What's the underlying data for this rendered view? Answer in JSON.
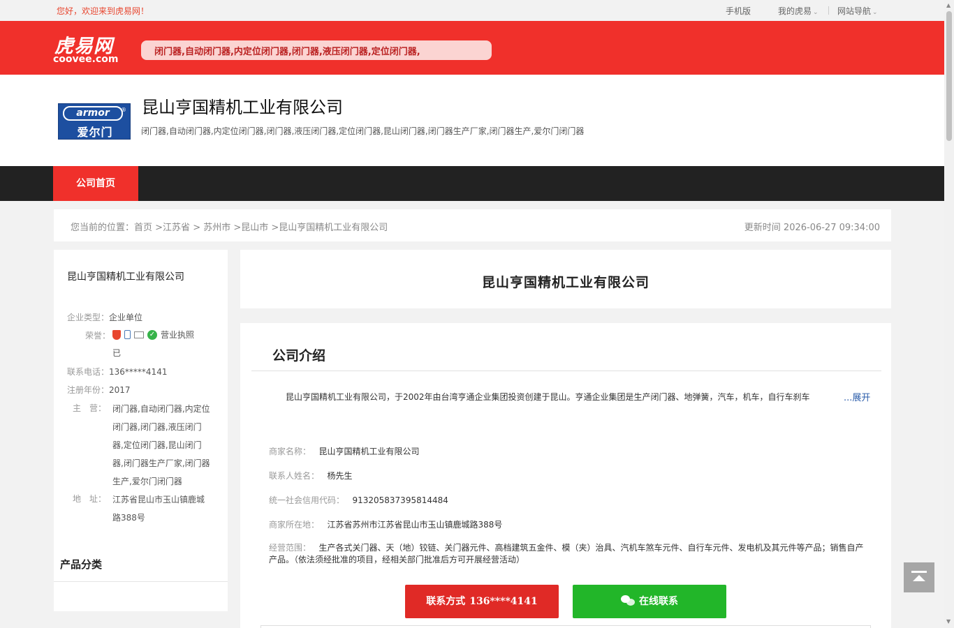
{
  "topbar": {
    "welcome": "您好，欢迎来到虎易网！",
    "mobile": "手机版",
    "mine": "我的虎易",
    "site_nav": "网站导航"
  },
  "header": {
    "logo_text": "虎易网",
    "logo_domain": "coovee.com",
    "keywords": "闭门器,自动闭门器,内定位闭门器,闭门器,液压闭门器,定位闭门器,"
  },
  "company": {
    "logo_brand": "armor",
    "logo_reg": "®",
    "logo_cn": "爱尔门",
    "name": "昆山亨国精机工业有限公司",
    "tags": "闭门器,自动闭门器,内定位闭门器,闭门器,液压闭门器,定位闭门器,昆山闭门器,闭门器生产厂家,闭门器生产,爱尔门闭门器"
  },
  "nav": {
    "home_tab": "公司首页"
  },
  "breadcrumb": {
    "prefix": "您当前的位置：",
    "items": [
      "首页",
      " >江苏省",
      " > 苏州市",
      " >昆山市",
      " >昆山亨国精机工业有限公司"
    ],
    "update_label": "更新时间",
    "update_time": "2026-06-27 09:34:00"
  },
  "sidebar": {
    "title": "昆山亨国精机工业有限公司",
    "type_label": "企业类型：",
    "type_value": "企业单位",
    "honor_label": "荣誉：",
    "honor_license": "营业执照",
    "honor_second": "已",
    "phone_label": "联系电话：",
    "phone_value": "136*****4141",
    "year_label": "注册年份：",
    "year_value": "2017",
    "main_label": "主　营：",
    "main_value": "闭门器,自动闭门器,内定位闭门器,闭门器,液压闭门器,定位闭门器,昆山闭门器,闭门器生产厂家,闭门器生产,爱尔门闭门器",
    "addr_label": "地　址：",
    "addr_value": "江苏省昆山市玉山镇鹿城路388号",
    "category_title": "产品分类"
  },
  "main": {
    "title": "昆山亨国精机工业有限公司",
    "intro_heading": "公司介绍",
    "intro_text": "昆山亨国精机工业有限公司，于2002年由台湾亨通企业集团投资创建于昆山。亨通企业集团是生产闭门器、地弹簧，汽车，机车，自行车刹车",
    "expand": "...展开",
    "info": [
      {
        "label": "商家名称：",
        "value": "昆山亨国精机工业有限公司"
      },
      {
        "label": "联系人姓名：",
        "value": "杨先生"
      },
      {
        "label": "统一社会信用代码：",
        "value": "913205837395814484"
      },
      {
        "label": "商家所在地：",
        "value": "江苏省苏州市江苏省昆山市玉山镇鹿城路388号"
      }
    ],
    "scope_label": "经营范围：",
    "scope_value": "生产各式关门器、天（地）铰链、关门器元件、高档建筑五金件、模（夹）治具、汽机车煞车元件、自行车元件、发电机及其元件等产品；销售自产产品。（依法须经批准的项目，经相关部门批准后方可开展经营活动）",
    "contact_button": "联系方式",
    "contact_number": "136****4141",
    "online_button": "在线联系"
  },
  "colors": {
    "brand_red": "#f0302b",
    "nav_dark": "#222222",
    "online_green": "#22b629",
    "link_blue": "#2a5caa"
  }
}
